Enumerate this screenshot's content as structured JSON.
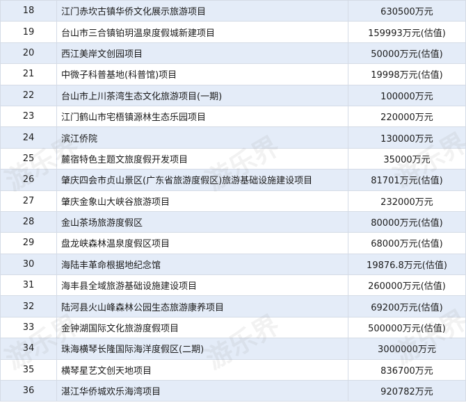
{
  "table": {
    "rows": [
      {
        "no": "18",
        "name": "江门赤坎古镇华侨文化展示旅游项目",
        "investment": "630500万元"
      },
      {
        "no": "19",
        "name": "台山市三合镇铂玥温泉度假城新建项目",
        "investment": "159993万元(估值)"
      },
      {
        "no": "20",
        "name": "西江美岸文创园项目",
        "investment": "50000万元(估值)"
      },
      {
        "no": "21",
        "name": "中微子科普基地(科普馆)项目",
        "investment": "19998万元(估值)"
      },
      {
        "no": "22",
        "name": "台山市上川茶湾生态文化旅游项目(一期)",
        "investment": "100000万元"
      },
      {
        "no": "23",
        "name": "江门鹤山市宅梧镇源林生态乐园项目",
        "investment": "220000万元"
      },
      {
        "no": "24",
        "name": "滨江侨院",
        "investment": "130000万元"
      },
      {
        "no": "25",
        "name": "麓宿特色主题文旅度假开发项目",
        "investment": "35000万元"
      },
      {
        "no": "26",
        "name": "肇庆四会市贞山景区(广东省旅游度假区)旅游基础设施建设项目",
        "investment": "81701万元(估值)"
      },
      {
        "no": "27",
        "name": "肇庆金象山大峡谷旅游项目",
        "investment": "232000万元"
      },
      {
        "no": "28",
        "name": "金山茶场旅游度假区",
        "investment": "80000万元(估值)"
      },
      {
        "no": "29",
        "name": "盘龙峡森林温泉度假区项目",
        "investment": "68000万元(估值)"
      },
      {
        "no": "30",
        "name": "海陆丰革命根据地纪念馆",
        "investment": "19876.8万元(估值)"
      },
      {
        "no": "31",
        "name": "海丰县全域旅游基础设施建设项目",
        "investment": "260000万元(估值)"
      },
      {
        "no": "32",
        "name": "陆河县火山峰森林公园生态旅游康养项目",
        "investment": "69200万元(估值)"
      },
      {
        "no": "33",
        "name": "金钟湖国际文化旅游度假项目",
        "investment": "500000万元(估值)"
      },
      {
        "no": "34",
        "name": "珠海横琴长隆国际海洋度假区(二期)",
        "investment": "3000000万元"
      },
      {
        "no": "35",
        "name": "横琴星艺文创天地项目",
        "investment": "836700万元"
      },
      {
        "no": "36",
        "name": "湛江华侨城欢乐海湾项目",
        "investment": "920782万元"
      }
    ]
  },
  "watermark": {
    "text": "游乐界"
  }
}
